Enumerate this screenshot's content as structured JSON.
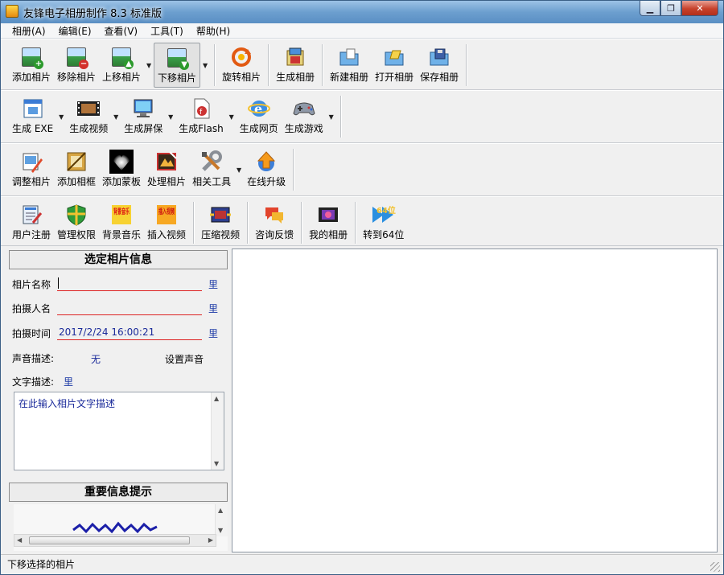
{
  "window": {
    "title": "友锋电子相册制作 8.3 标准版",
    "minimize": "▁",
    "maximize": "❐",
    "close": "✕"
  },
  "menu": [
    {
      "label": "相册(A)"
    },
    {
      "label": "编辑(E)"
    },
    {
      "label": "查看(V)"
    },
    {
      "label": "工具(T)"
    },
    {
      "label": "帮助(H)"
    }
  ],
  "toolbar1": {
    "add_photo": "添加相片",
    "remove_photo": "移除相片",
    "move_up": "上移相片",
    "move_down": "下移相片",
    "rotate": "旋转相片",
    "build_album": "生成相册",
    "new_album": "新建相册",
    "open_album": "打开相册",
    "save_album": "保存相册"
  },
  "toolbar2": {
    "gen_exe": "生成 EXE",
    "gen_video": "生成视频",
    "gen_screensaver": "生成屏保",
    "gen_flash": "生成Flash",
    "gen_web": "生成网页",
    "gen_game": "生成游戏"
  },
  "toolbar3": {
    "adjust_photo": "调整相片",
    "add_frame": "添加相框",
    "add_mask": "添加蒙板",
    "process_photo": "处理相片",
    "related_tools": "相关工具",
    "online_upgrade": "在线升级"
  },
  "toolbar4": {
    "register": "用户注册",
    "permissions": "管理权限",
    "bg_music": "背景音乐",
    "insert_video": "插入视频",
    "compress_video": "压缩视频",
    "feedback": "咨询反馈",
    "my_album": "我的相册",
    "to_64bit": "转到64位",
    "music_icon_text": "背景音乐",
    "video_icon_text": "插入视频",
    "bit64_icon_text": "64位"
  },
  "photo_info": {
    "heading": "选定相片信息",
    "name_label": "相片名称",
    "name_value": "",
    "photographer_label": "拍摄人名",
    "photographer_value": "",
    "time_label": "拍摄时间",
    "time_value": "2017/2/24 16:00:21",
    "sound_label": "声音描述:",
    "sound_value": "无",
    "set_sound": "设置声音",
    "text_label": "文字描述:",
    "text_placeholder": "在此输入相片文字描述",
    "edit_glyph": "里"
  },
  "tips": {
    "heading": "重要信息提示"
  },
  "status": {
    "text": "下移选择的相片"
  },
  "colors": {
    "title_gradient_top": "#9cc2e6",
    "accent_blue": "#1a2a9a",
    "underline_red": "#dd2222",
    "close_red": "#c7412b"
  }
}
